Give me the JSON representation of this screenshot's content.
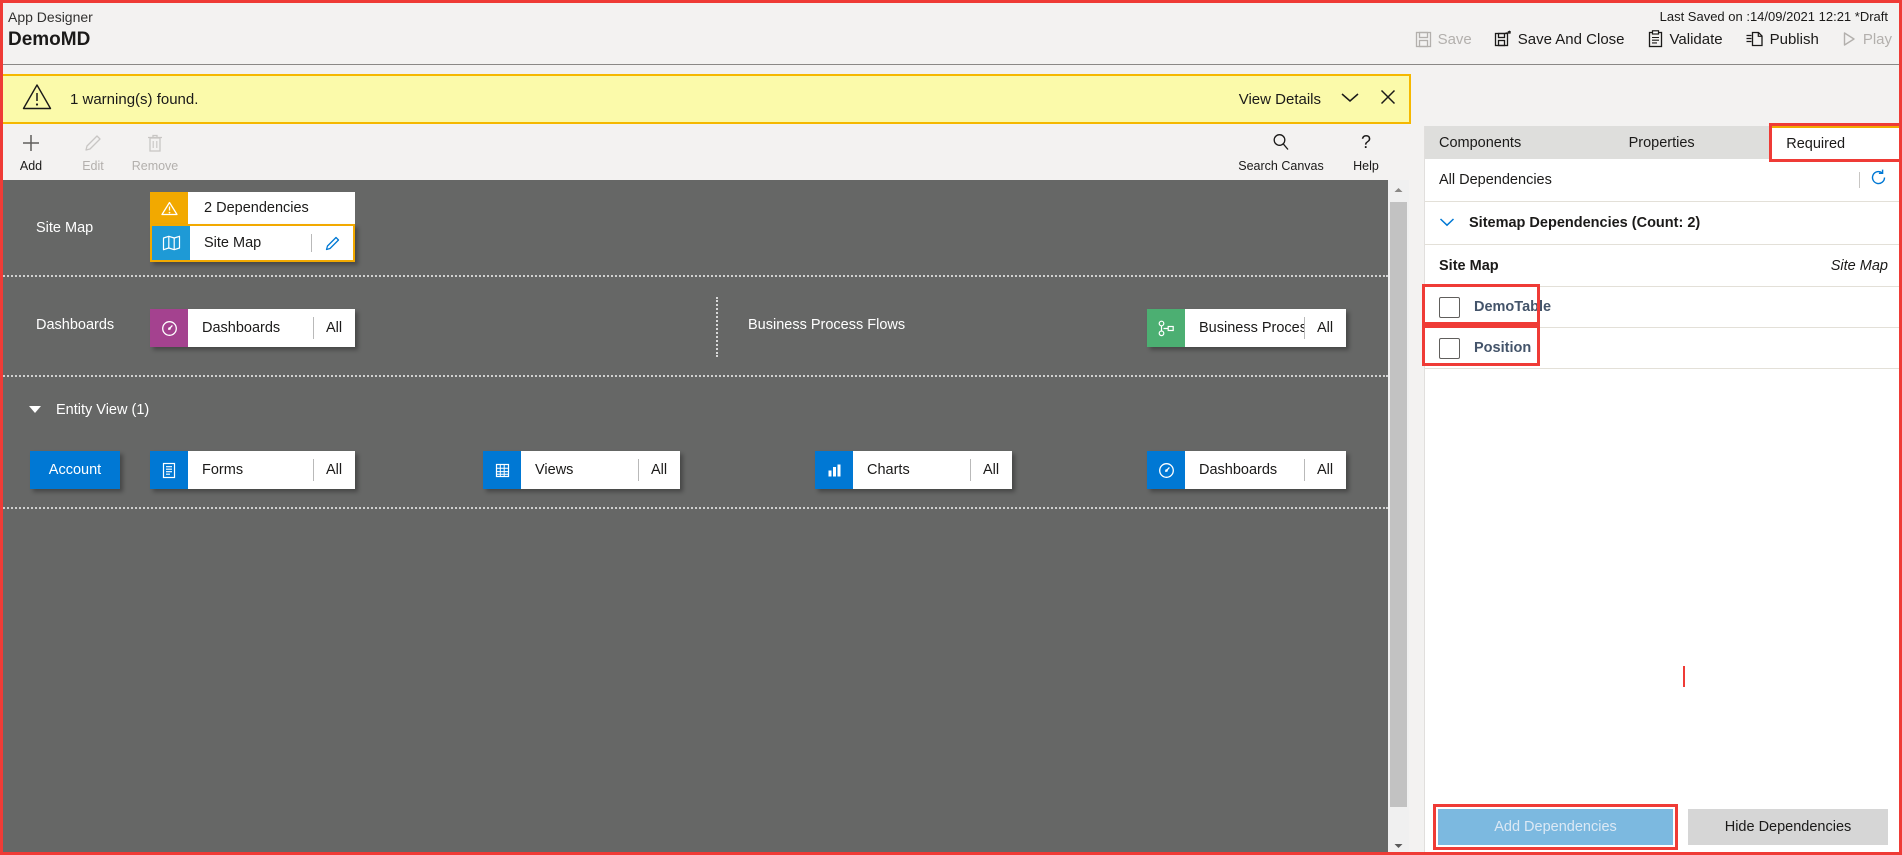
{
  "header": {
    "app_label": "App Designer",
    "app_title": "DemoMD",
    "last_saved": "Last Saved on :14/09/2021 12:21 *Draft",
    "commands": [
      {
        "label": "Save",
        "icon": "save-icon",
        "disabled": true
      },
      {
        "label": "Save And Close",
        "icon": "save-and-close-icon",
        "disabled": false
      },
      {
        "label": "Validate",
        "icon": "validate-icon",
        "disabled": false
      },
      {
        "label": "Publish",
        "icon": "publish-icon",
        "disabled": false
      },
      {
        "label": "Play",
        "icon": "play-icon",
        "disabled": true
      }
    ]
  },
  "warning_bar": {
    "icon": "warning-triangle-icon",
    "message": "1 warning(s) found.",
    "view_details_label": "View Details",
    "chevron_icon": "chevron-down-icon",
    "close_icon": "close-icon",
    "background": "#fbfaaa",
    "border": "#f5b800"
  },
  "toolbar": {
    "left": [
      {
        "label": "Add",
        "icon": "plus-icon",
        "disabled": false
      },
      {
        "label": "Edit",
        "icon": "pencil-icon",
        "disabled": true
      },
      {
        "label": "Remove",
        "icon": "trash-icon",
        "disabled": true
      }
    ],
    "right": [
      {
        "label": "Search Canvas",
        "icon": "search-icon",
        "disabled": false
      },
      {
        "label": "Help",
        "icon": "question-icon",
        "disabled": false
      }
    ]
  },
  "canvas": {
    "background": "#666766",
    "rows": [
      {
        "label": "Site Map",
        "dependency_banner": {
          "icon": "warning-triangle-icon",
          "text": "2 Dependencies",
          "badge_color": "#f2a900"
        },
        "tile": {
          "name": "Site Map",
          "icon": "sitemap-icon",
          "icon_color": "#1e9ad6",
          "edit_icon": "pencil-icon",
          "selected": true
        }
      },
      {
        "label": "Dashboards",
        "tile": {
          "name": "Dashboards",
          "icon": "dashboard-icon",
          "icon_color": "#a4428f",
          "count": "All"
        }
      },
      {
        "label": "Business Process Flows",
        "tile": {
          "name": "Business Proces...",
          "icon": "process-flow-icon",
          "icon_color": "#4caf72",
          "count": "All"
        }
      }
    ],
    "entity_view": {
      "header": "Entity View (1)",
      "collapse_icon": "caret-down-icon",
      "entity_chip": "Account",
      "tiles": [
        {
          "name": "Forms",
          "icon": "form-icon",
          "icon_color": "#0078d4",
          "count": "All"
        },
        {
          "name": "Views",
          "icon": "grid-icon",
          "icon_color": "#0078d4",
          "count": "All"
        },
        {
          "name": "Charts",
          "icon": "bar-chart-icon",
          "icon_color": "#0078d4",
          "count": "All"
        },
        {
          "name": "Dashboards",
          "icon": "dashboard-icon",
          "icon_color": "#0078d4",
          "count": "All"
        }
      ]
    },
    "scrollbar": {
      "up_icon": "scroll-up-arrow",
      "down_icon": "scroll-down-arrow"
    }
  },
  "right_panel": {
    "tabs": [
      {
        "label": "Components",
        "selected": false
      },
      {
        "label": "Properties",
        "selected": false
      },
      {
        "label": "Required",
        "selected": true,
        "highlighted": true
      }
    ],
    "all_dependencies_label": "All Dependencies",
    "refresh_icon": "refresh-icon",
    "sitemap_dependencies_label": "Sitemap Dependencies (Count: 2)",
    "sitemap_dependencies_chevron": "chevron-down-icon",
    "dependency_group": {
      "name": "Site Map",
      "type": "Site Map"
    },
    "dependency_items": [
      {
        "label": "DemoTable",
        "checked": false,
        "highlighted": true
      },
      {
        "label": "Position",
        "checked": false,
        "highlighted": true
      }
    ],
    "footer": {
      "add_label": "Add Dependencies",
      "add_disabled": true,
      "add_highlighted": true,
      "hide_label": "Hide Dependencies"
    }
  },
  "colors": {
    "accent": "#0078d4",
    "warning": "#f2a900",
    "highlight_red": "#ef3b36",
    "canvas_gray": "#666766",
    "panel_tab_bg": "#dededc"
  }
}
